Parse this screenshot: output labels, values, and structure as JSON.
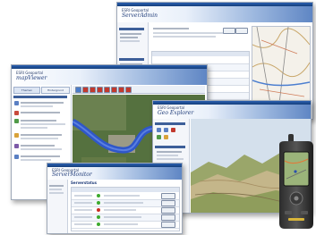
{
  "apps": {
    "server_admin": {
      "brand": "ESRI Geoportal",
      "title": "ServerAdmin"
    },
    "viewer": {
      "brand": "ESRI Geoportal",
      "title": "mapViewer",
      "tab1": "Themen",
      "tab2": "Hintergrund"
    },
    "explorer": {
      "brand": "ESRI Geoportal",
      "title": "Geo Explorer",
      "menu": [
        "Einstellungen",
        "Navigation",
        "Modellierung"
      ]
    },
    "monitor": {
      "brand": "ESRI Geoportal",
      "title": "ServerMonitor",
      "section": "Serverstatus"
    }
  },
  "colors": {
    "accent": "#2a5fb0",
    "header_blue": "#5f86c4",
    "river": "#2f57c9",
    "status_green": "#3caa2e",
    "status_red": "#cc2d22"
  },
  "icons": [
    "globe-icon",
    "zoom-in-icon",
    "zoom-out-icon",
    "pan-icon",
    "info-icon",
    "print-icon",
    "measure-icon",
    "gps-device-icon"
  ]
}
